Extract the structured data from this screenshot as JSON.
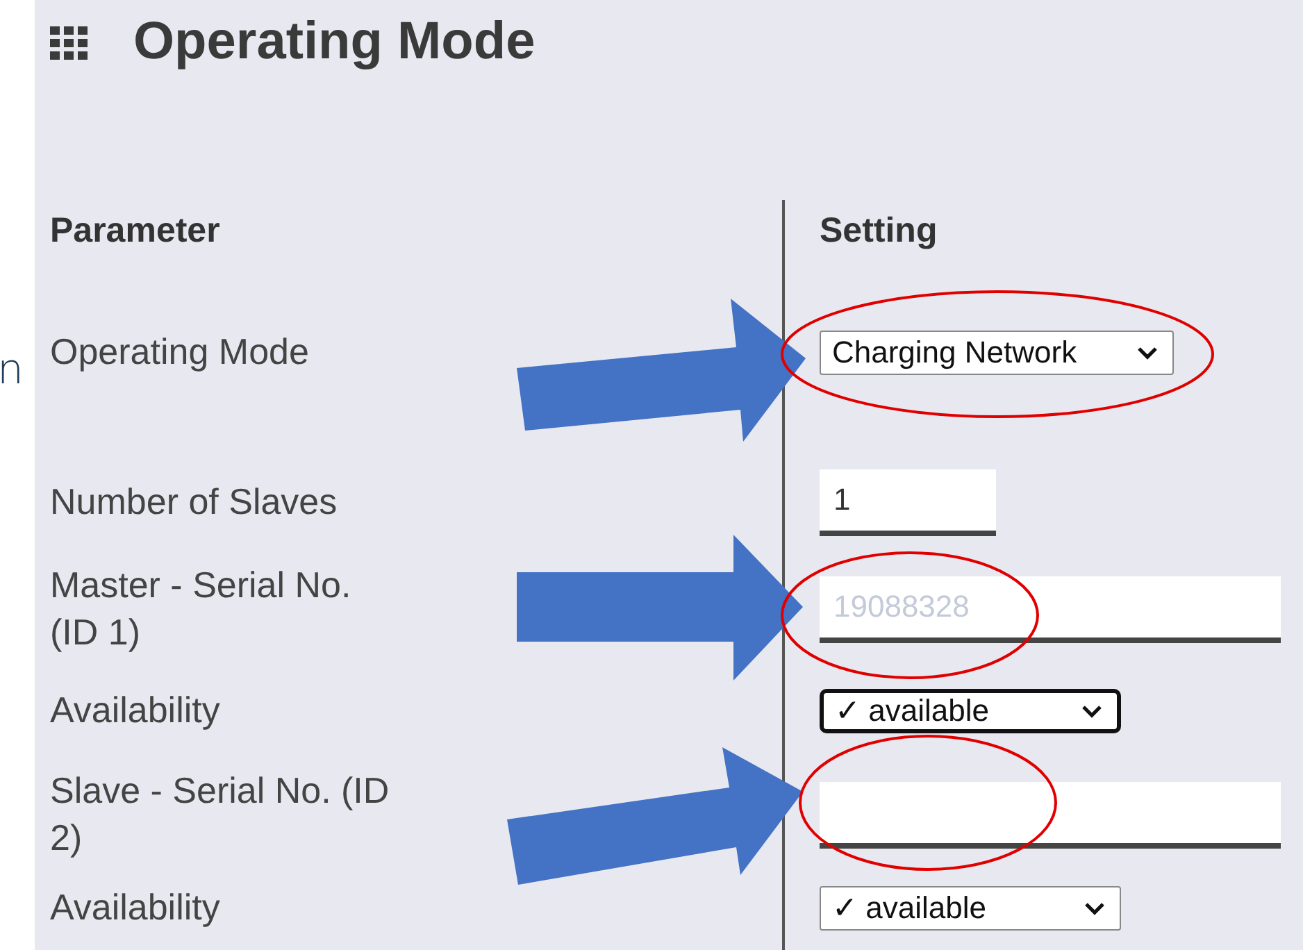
{
  "side_text": "n",
  "title": "Operating Mode",
  "columns": [
    "Parameter",
    "Setting"
  ],
  "rows": [
    {
      "label": "Operating Mode",
      "kind": "select",
      "value": "Charging Network",
      "focused": false
    },
    {
      "label": "Number of Slaves",
      "kind": "input",
      "value": "1"
    },
    {
      "label": "Master - Serial No. (ID 1)",
      "kind": "input",
      "placeholder": "19088328"
    },
    {
      "label": "Availability",
      "kind": "select",
      "value": "✓ available",
      "focused": true
    },
    {
      "label": "Slave - Serial No. (ID 2)",
      "kind": "input"
    },
    {
      "label": "Availability",
      "kind": "select",
      "value": "✓ available",
      "focused": false
    }
  ]
}
